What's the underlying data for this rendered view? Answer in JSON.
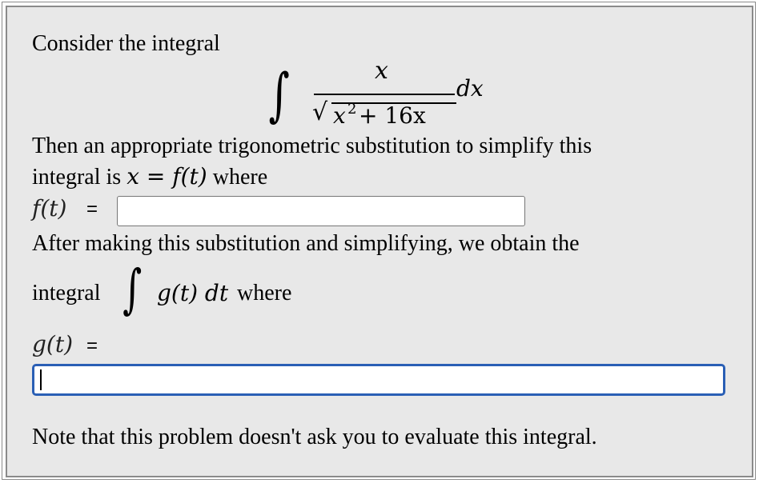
{
  "intro": "Consider the integral",
  "integral": {
    "sign": "∫",
    "numerator": "x",
    "sqrt_symbol": "√",
    "denominator_base": "x",
    "denominator_exp": "2",
    "denominator_rest": " + 16x",
    "differential": "dx"
  },
  "substitution": {
    "line1": "Then an appropriate trigonometric substitution to simplify this",
    "line2_prefix": "integral is ",
    "line2_math": "x = f(t)",
    "line2_suffix": " where"
  },
  "f_field": {
    "label": "f(t)",
    "equals": "=",
    "value": ""
  },
  "after": {
    "line1": "After making this substitution and simplifying, we obtain the",
    "integral_prefix": "integral",
    "integral_sign": "∫",
    "integral_math": "g(t) dt",
    "integral_suffix": " where"
  },
  "g_field": {
    "label": "g(t)",
    "equals": "=",
    "value": ""
  },
  "note": "Note that this problem doesn't ask you to evaluate this integral."
}
